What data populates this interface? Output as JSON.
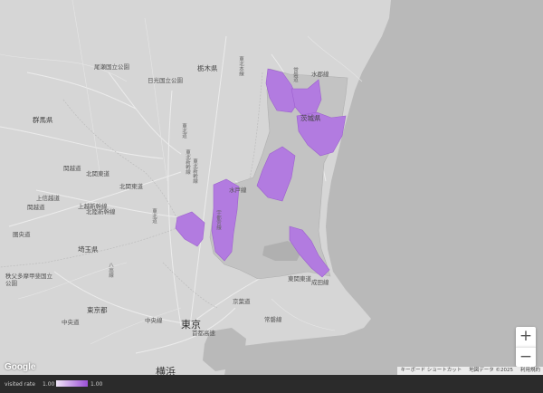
{
  "map": {
    "type": "choropleth",
    "region": "Kanto, Japan (Ibaraki prefecture municipalities highlighted)",
    "labels": {
      "prefectures": [
        "群馬県",
        "栃木県",
        "埼玉県",
        "東京都",
        "茨城県"
      ],
      "cities": [
        "東京",
        "横浜"
      ],
      "parks": [
        "尾瀬国立公園",
        "日光国立公園",
        "秩父多摩甲斐国立公園"
      ],
      "roads": [
        "上信越道",
        "関越道",
        "北関東道",
        "東北道",
        "圏央道",
        "常磐道",
        "東北新幹線",
        "中央線",
        "東関東道",
        "東北道",
        "北関東道",
        "東北本線",
        "東北新幹線",
        "上越新幹線",
        "八高線",
        "首都高速",
        "京葉道",
        "常磐線",
        "成田線",
        "水郡線",
        "水戸線",
        "中央道",
        "宇都宮線",
        "関越道",
        "北陸新幹線"
      ]
    },
    "regions": [
      {
        "name": "northern-ibaraki-west",
        "rate": 1.0
      },
      {
        "name": "northern-ibaraki-east",
        "rate": 1.0
      },
      {
        "name": "central-ibaraki",
        "rate": 1.0
      },
      {
        "name": "western-ibaraki-north",
        "rate": 1.0
      },
      {
        "name": "western-ibaraki-south",
        "rate": 1.0
      },
      {
        "name": "southwest-ibaraki",
        "rate": 1.0
      },
      {
        "name": "southeast-ibaraki",
        "rate": 1.0
      }
    ],
    "colors": {
      "land": "#d6d6d6",
      "sea": "#b9b9b9",
      "ibaraki_fill": "#c3c3c3",
      "visited_fill": "#b27be0",
      "legend_low": "#f0e6f8",
      "legend_high": "#9b4fd6"
    }
  },
  "controls": {
    "zoom_in": "+",
    "zoom_out": "−"
  },
  "attribution": {
    "google": "Google",
    "shortcuts": "キーボード ショートカット",
    "map_data": "地図データ ©2025",
    "terms": "利用規約"
  },
  "legend": {
    "title": "visited rate",
    "min": "1.00",
    "max": "1.00"
  }
}
